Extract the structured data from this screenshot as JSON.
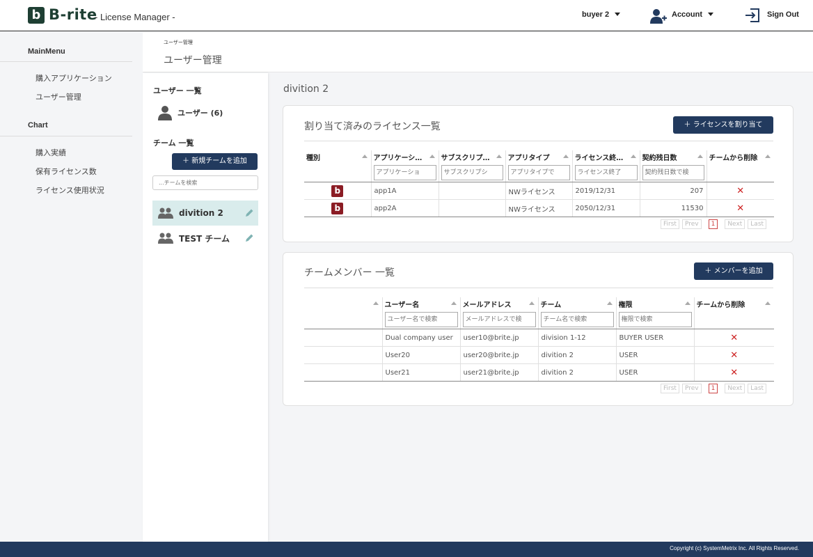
{
  "header": {
    "logo_letter": "b",
    "brand": "B-rite",
    "subtitle": "- License Manager -",
    "user_menu": "buyer 2",
    "account": "Account",
    "signout": "Sign Out"
  },
  "sidebar": {
    "mainmenu_heading": "MainMenu",
    "mainmenu_items": [
      "購入アプリケーション",
      "ユーザー管理"
    ],
    "chart_heading": "Chart",
    "chart_items": [
      "購入実績",
      "保有ライセンス数",
      "ライセンス使用状況"
    ]
  },
  "breadcrumb": {
    "small": "ユーザー管理",
    "title": "ユーザー管理"
  },
  "team_panel": {
    "user_list_heading": "ユーザー 一覧",
    "users_label": "ユーザー (6)",
    "team_list_heading": "チーム 一覧",
    "add_team_button": "＋ 新規チームを追加",
    "team_search_placeholder": "...チームを検索",
    "teams": [
      "divition 2",
      "TEST チーム"
    ]
  },
  "content": {
    "division_title": "divition 2",
    "licenses": {
      "title": "割り当て済みのライセンス一覧",
      "assign_button": "＋ ライセンスを割り当て",
      "columns": [
        "種別",
        "アプリケーシ…",
        "サブスクリプ…",
        "アプリタイプ",
        "ライセンス終…",
        "契約残日数",
        "チームから削除"
      ],
      "filters": [
        "",
        "アプリケーショ",
        "サブスクリプシ",
        "アプリタイプで",
        "ライセンス終了",
        "契約残日数で検",
        ""
      ],
      "rows": [
        {
          "app": "app1A",
          "subscription": "",
          "type": "NWライセンス",
          "end": "2019/12/31",
          "days": "207"
        },
        {
          "app": "app2A",
          "subscription": "",
          "type": "NWライセンス",
          "end": "2050/12/31",
          "days": "11530"
        }
      ],
      "pager": {
        "first": "First",
        "prev": "Prev",
        "page": "1",
        "next": "Next",
        "last": "Last"
      }
    },
    "members": {
      "title": "チームメンバー 一覧",
      "add_button": "＋ メンバーを追加",
      "columns": [
        "",
        "ユーザー名",
        "メールアドレス",
        "チーム",
        "権限",
        "チームから削除"
      ],
      "filters": [
        "",
        "ユーザー名で検索",
        "メールアドレスで検",
        "チーム名で検索",
        "権限で検索",
        ""
      ],
      "rows": [
        {
          "name": "Dual company user",
          "email": "user10@brite.jp",
          "team": "division 1-12",
          "role": "BUYER USER"
        },
        {
          "name": "User20",
          "email": "user20@brite.jp",
          "team": "divition 2",
          "role": "USER"
        },
        {
          "name": "User21",
          "email": "user21@brite.jp",
          "team": "divition 2",
          "role": "USER"
        }
      ],
      "pager": {
        "first": "First",
        "prev": "Prev",
        "page": "1",
        "next": "Next",
        "last": "Last"
      }
    },
    "delete_mark": "✕"
  },
  "footer": {
    "copyright": "Copyright (c) SystemMetrix Inc. All Rights Reserved."
  },
  "colors": {
    "brand_green": "#1e3f33",
    "navy": "#223a5e",
    "app_icon_red": "#8b1c24",
    "delete_red": "#cc1f1f",
    "active_team_bg": "#d9ecec"
  }
}
